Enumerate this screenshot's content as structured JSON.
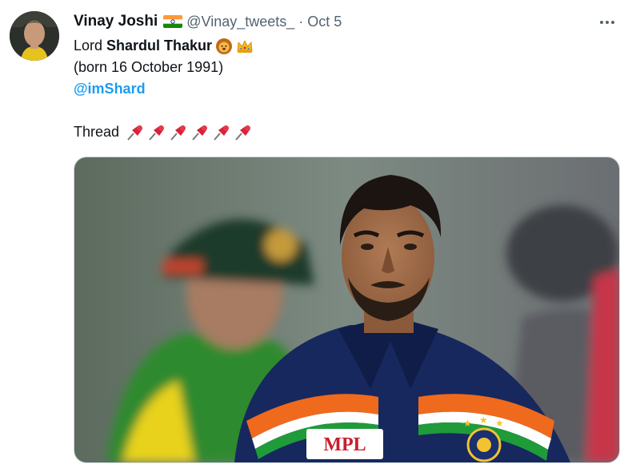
{
  "tweet": {
    "author_name": "Vinay Joshi",
    "handle": "@Vinay_tweets_",
    "separator": "·",
    "date": "Oct 5",
    "lines": {
      "lord_prefix": "Lord",
      "lord_name": "Shardul Thakur",
      "born": "(born 16 October 1991)",
      "mention": "@imShard",
      "thread": "Thread"
    },
    "icons": {
      "flag": "india-flag-icon",
      "lion": "lion-emoji-icon",
      "crown": "crown-emoji-icon",
      "pin": "pushpin-emoji-icon",
      "more": "more-options-icon"
    },
    "pin_count": 6,
    "colors": {
      "text": "#0f1419",
      "secondary": "#536471",
      "link": "#1d9bf0",
      "border": "#cfd9de"
    }
  }
}
